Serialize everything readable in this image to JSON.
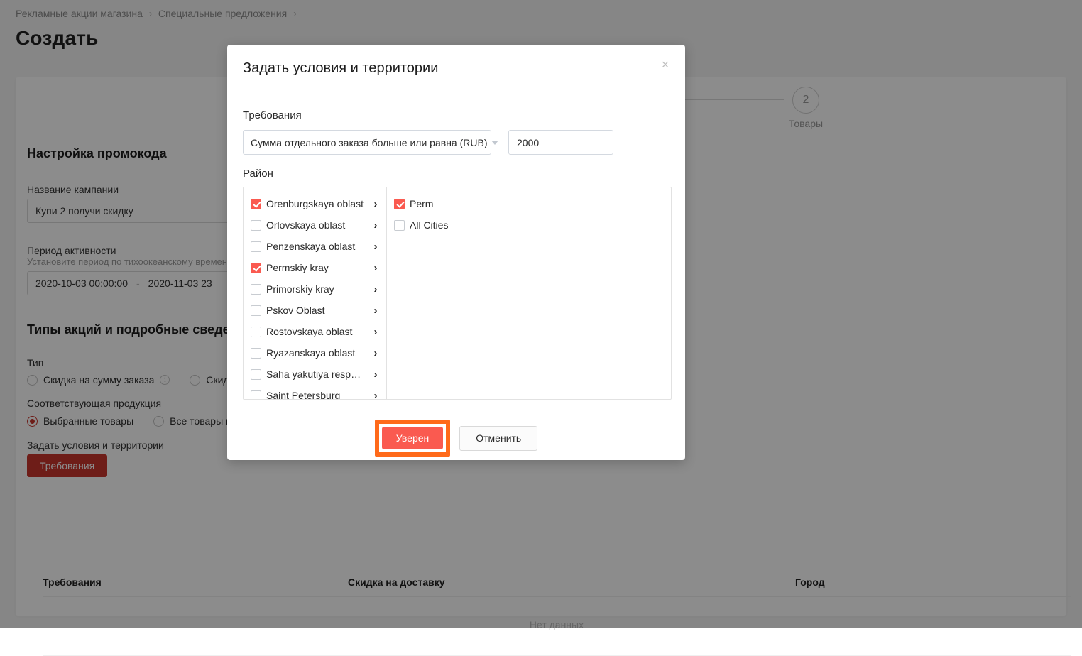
{
  "breadcrumb": {
    "items": [
      "Рекламные акции магазина",
      "Специальные предложения"
    ],
    "separator": "›"
  },
  "page": {
    "title": "Создать"
  },
  "steps": {
    "number": "2",
    "label": "Товары"
  },
  "promo": {
    "section_title": "Настройка промокода",
    "campaign_label": "Название кампании",
    "campaign_value": "Купи 2 получи скидку",
    "period_label": "Период активности",
    "period_hint": "Установите период по тихоокеанскому времени",
    "period_start": "2020-10-03 00:00:00",
    "period_end": "2020-11-03 23",
    "period_dash": "-"
  },
  "types": {
    "section_title": "Типы акций и подробные сведения",
    "type_label": "Тип",
    "type_options": [
      {
        "label": "Скидка на сумму заказа",
        "selected": false,
        "info": "i"
      },
      {
        "label": "Скидка пр",
        "selected": false
      }
    ],
    "product_label": "Соответствующая продукция",
    "product_options": [
      {
        "label": "Выбранные товары",
        "selected": true
      },
      {
        "label": "Все товары в ма",
        "selected": false
      }
    ],
    "conditions_label": "Задать условия и территории",
    "requirements_button": "Требования"
  },
  "table": {
    "columns": [
      "Требования",
      "Скидка на доставку",
      "Город"
    ],
    "empty_text": "Нет данных"
  },
  "modal": {
    "title": "Задать условия и территории",
    "close_icon": "×",
    "requirements_label": "Требования",
    "condition_select": "Сумма отдельного заказа больше или равна (RUB)",
    "condition_value": "2000",
    "region_label": "Район",
    "regions": [
      {
        "label": "Orenburgskaya oblast",
        "checked": true
      },
      {
        "label": "Orlovskaya oblast",
        "checked": false
      },
      {
        "label": "Penzenskaya oblast",
        "checked": false
      },
      {
        "label": "Permskiy kray",
        "checked": true
      },
      {
        "label": "Primorskiy kray",
        "checked": false
      },
      {
        "label": "Pskov Oblast",
        "checked": false
      },
      {
        "label": "Rostovskaya oblast",
        "checked": false
      },
      {
        "label": "Ryazanskaya oblast",
        "checked": false
      },
      {
        "label": "Saha yakutiya respublika",
        "checked": false
      },
      {
        "label": "Saint Petersburg",
        "checked": false
      }
    ],
    "cities": [
      {
        "label": "Perm",
        "checked": true
      },
      {
        "label": "All Cities",
        "checked": false
      }
    ],
    "confirm_button": "Уверен",
    "cancel_button": "Отменить"
  },
  "colors": {
    "accent_red": "#fa5a50",
    "brand_red": "#c8352c",
    "highlight_orange": "#ff6a1a"
  }
}
